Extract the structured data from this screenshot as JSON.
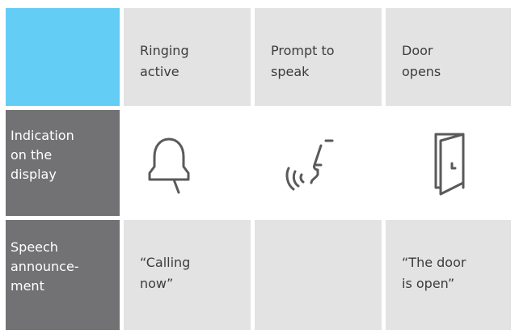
{
  "header": {
    "col1": "Ringing\nactive",
    "col2": "Prompt to\nspeak",
    "col3": "Door\nopens"
  },
  "rows": {
    "indication": {
      "label": "Indication\non the\ndisplay",
      "icons": [
        "bell-icon",
        "speaking-head-icon",
        "open-door-icon"
      ]
    },
    "speech": {
      "label": "Speech\nannounce-\nment",
      "col1": "“Calling\nnow”",
      "col2": "",
      "col3": "“The door\nis open”"
    }
  },
  "colors": {
    "accent": "#64cdf5",
    "header_bg": "#e3e3e3",
    "row_label_bg": "#727274",
    "icon_stroke": "#5a5a5a"
  }
}
